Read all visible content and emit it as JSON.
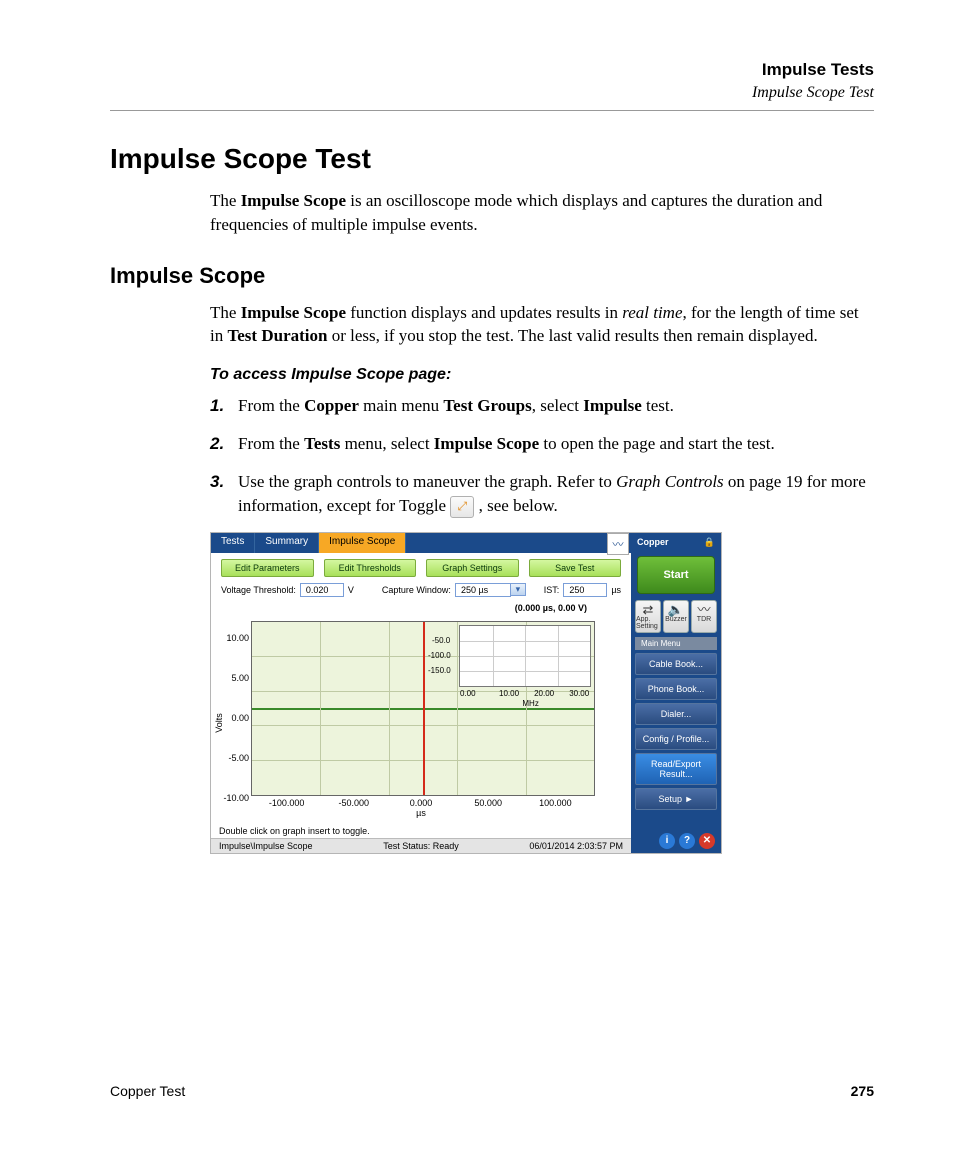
{
  "header": {
    "chapter": "Impulse Tests",
    "section": "Impulse Scope Test"
  },
  "h1": "Impulse Scope Test",
  "intro": "The Impulse Scope is an oscilloscope mode which displays and captures the duration and frequencies of multiple impulse events.",
  "h2": "Impulse Scope",
  "desc": "The Impulse Scope function displays and updates results in real time, for the length of time set in Test Duration or less, if you stop the test. The last valid results then remain displayed.",
  "task_title": "To access Impulse Scope page:",
  "steps": [
    "From the Copper main menu Test Groups, select Impulse test.",
    "From the Tests menu, select Impulse Scope to open the page and start the test.",
    "Use the graph controls to maneuver the graph. Refer to Graph Controls on page 19 for more information, except for Toggle , see below."
  ],
  "screenshot": {
    "tabs": [
      "Tests",
      "Summary",
      "Impulse Scope"
    ],
    "active_tab": 2,
    "buttons": [
      "Edit Parameters",
      "Edit Thresholds",
      "Graph Settings",
      "Save Test"
    ],
    "params": {
      "threshold_label": "Voltage Threshold:",
      "threshold_value": "0.020",
      "threshold_unit": "V",
      "capture_label": "Capture Window:",
      "capture_value": "250 µs",
      "ist_label": "IST:",
      "ist_value": "250",
      "ist_unit": "µs"
    },
    "cursor_readout": "(0.000 µs, 0.00 V)",
    "y_ticks": [
      "10.00",
      "5.00",
      "0.00",
      "-5.00",
      "-10.00"
    ],
    "y_label": "Volts",
    "x_ticks": [
      "-100.000",
      "-50.000",
      "0.000",
      "50.000",
      "100.000"
    ],
    "x_unit": "µs",
    "inset": {
      "y_ticks": [
        "-50.0",
        "-100.0",
        "-150.0"
      ],
      "x_ticks": [
        "0.00",
        "10.00",
        "20.00",
        "30.00"
      ],
      "x_unit": "MHz"
    },
    "tool_icons": [
      "toggle",
      "pointer",
      "hand",
      "marker",
      "magnify",
      "zoom-in",
      "zoom-out"
    ],
    "hint": "Double click on graph insert to toggle.",
    "status": {
      "breadcrumb": "Impulse\\Impulse Scope",
      "status": "Test Status: Ready",
      "datetime": "06/01/2014 2:03:57 PM"
    },
    "side": {
      "title": "Copper",
      "start": "Start",
      "iconrow": [
        {
          "icon": "⇄",
          "label": "App. Setting"
        },
        {
          "icon": "🔈",
          "label": "Buzzer"
        },
        {
          "icon": "〰",
          "label": "TDR"
        }
      ],
      "mainmenu_header": "Main Menu",
      "items": [
        "Cable Book...",
        "Phone Book...",
        "Dialer...",
        "Config / Profile...",
        "Read/Export Result...",
        "Setup     ►"
      ],
      "highlight_index": 4
    }
  },
  "footer": {
    "product": "Copper Test",
    "page": "275"
  }
}
